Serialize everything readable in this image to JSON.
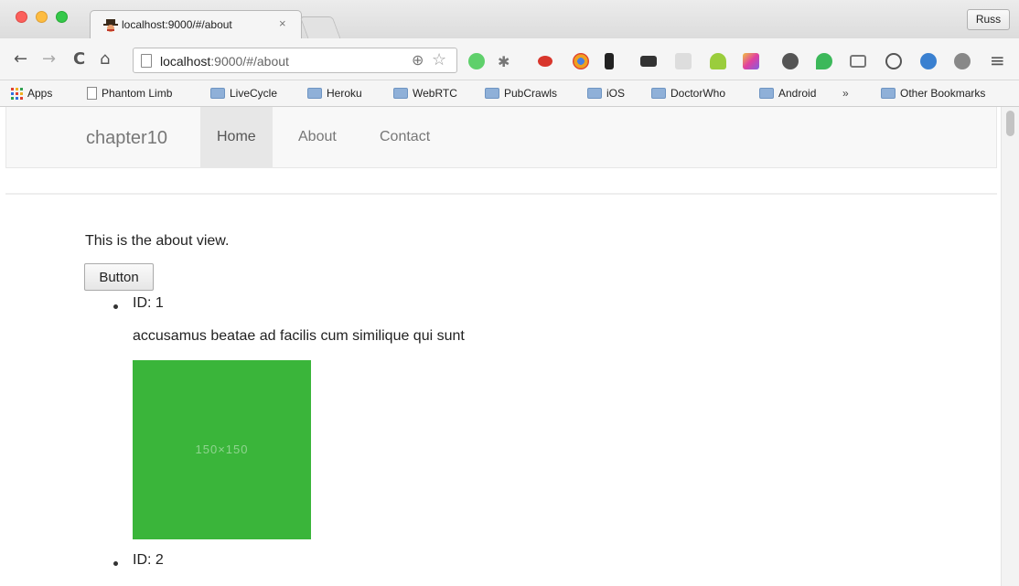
{
  "browser": {
    "tab_title": "localhost:9000/#/about",
    "tab_close": "×",
    "profile": "Russ",
    "url_host": "localhost",
    "url_rest": ":9000/#/about"
  },
  "bookmarks": [
    {
      "label": "Apps",
      "kind": "apps"
    },
    {
      "label": "Phantom Limb",
      "kind": "page"
    },
    {
      "label": "LiveCycle",
      "kind": "folder"
    },
    {
      "label": "Heroku",
      "kind": "folder"
    },
    {
      "label": "WebRTC",
      "kind": "folder"
    },
    {
      "label": "PubCrawls",
      "kind": "folder"
    },
    {
      "label": "iOS",
      "kind": "folder"
    },
    {
      "label": "DoctorWho",
      "kind": "folder"
    },
    {
      "label": "Android",
      "kind": "folder"
    }
  ],
  "bookmarks_overflow": "»",
  "bookmarks_other": "Other Bookmarks",
  "navbar": {
    "brand": "chapter10",
    "links": [
      "Home",
      "About",
      "Contact"
    ],
    "active": "Home"
  },
  "page": {
    "about_text": "This is the about view.",
    "button_label": "Button",
    "items": [
      {
        "id_label": "ID: 1",
        "description": "accusamus beatae ad facilis cum similique qui sunt",
        "image_label": "150×150",
        "image_color": "#3ab53a"
      },
      {
        "id_label": "ID: 2"
      }
    ]
  }
}
